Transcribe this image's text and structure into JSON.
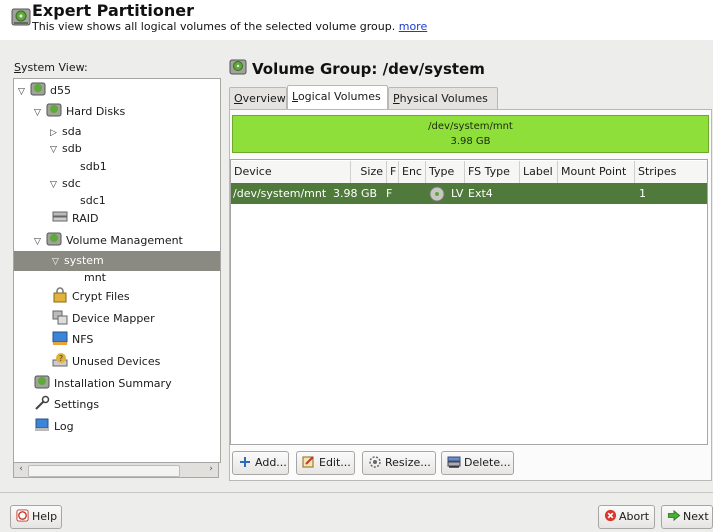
{
  "header": {
    "title": "Expert Partitioner",
    "subtitle": "This view shows all logical volumes of the selected volume group.",
    "more_link": "more"
  },
  "system_view": {
    "label": "System View:",
    "nodes": [
      {
        "label": "d55",
        "icon": "harddisk-icon"
      },
      {
        "label": "Hard Disks",
        "icon": "harddisk-icon"
      },
      {
        "label": "sda"
      },
      {
        "label": "sdb"
      },
      {
        "label": "sdb1"
      },
      {
        "label": "sdc"
      },
      {
        "label": "sdc1"
      },
      {
        "label": "RAID",
        "icon": "raid-icon"
      },
      {
        "label": "Volume Management",
        "icon": "harddisk-icon"
      },
      {
        "label": "system"
      },
      {
        "label": "mnt"
      },
      {
        "label": "Crypt Files",
        "icon": "lock-icon"
      },
      {
        "label": "Device Mapper",
        "icon": "device-mapper-icon"
      },
      {
        "label": "NFS",
        "icon": "nfs-icon"
      },
      {
        "label": "Unused Devices",
        "icon": "unused-devices-icon"
      },
      {
        "label": "Installation Summary",
        "icon": "harddisk-icon"
      },
      {
        "label": "Settings",
        "icon": "wrench-icon"
      },
      {
        "label": "Log",
        "icon": "log-icon"
      }
    ]
  },
  "volume_group": {
    "title": "Volume Group: /dev/system",
    "tabs": [
      "Overview",
      "Logical Volumes",
      "Physical Volumes"
    ],
    "active_tab": "Logical Volumes",
    "bar": {
      "name": "/dev/system/mnt",
      "size": "3.98 GB",
      "color": "#8fdf3b"
    }
  },
  "table": {
    "columns": [
      "Device",
      "Size",
      "F",
      "Enc",
      "Type",
      "FS Type",
      "Label",
      "Mount Point",
      "Stripes"
    ],
    "rows": [
      {
        "device": "/dev/system/mnt",
        "size": "3.98 GB",
        "f": "F",
        "enc": "",
        "type": "LV",
        "fs_type": "Ext4",
        "label": "",
        "mount_point": "",
        "stripes": "1"
      }
    ]
  },
  "buttons": {
    "add": "Add...",
    "edit": "Edit...",
    "resize": "Resize...",
    "delete": "Delete..."
  },
  "footer": {
    "help": "Help",
    "abort": "Abort",
    "next": "Next"
  },
  "colors": {
    "selected_row": "#4f7a3c",
    "selected_tree": "#8a8a82",
    "accent_link": "#1b3bd1"
  }
}
